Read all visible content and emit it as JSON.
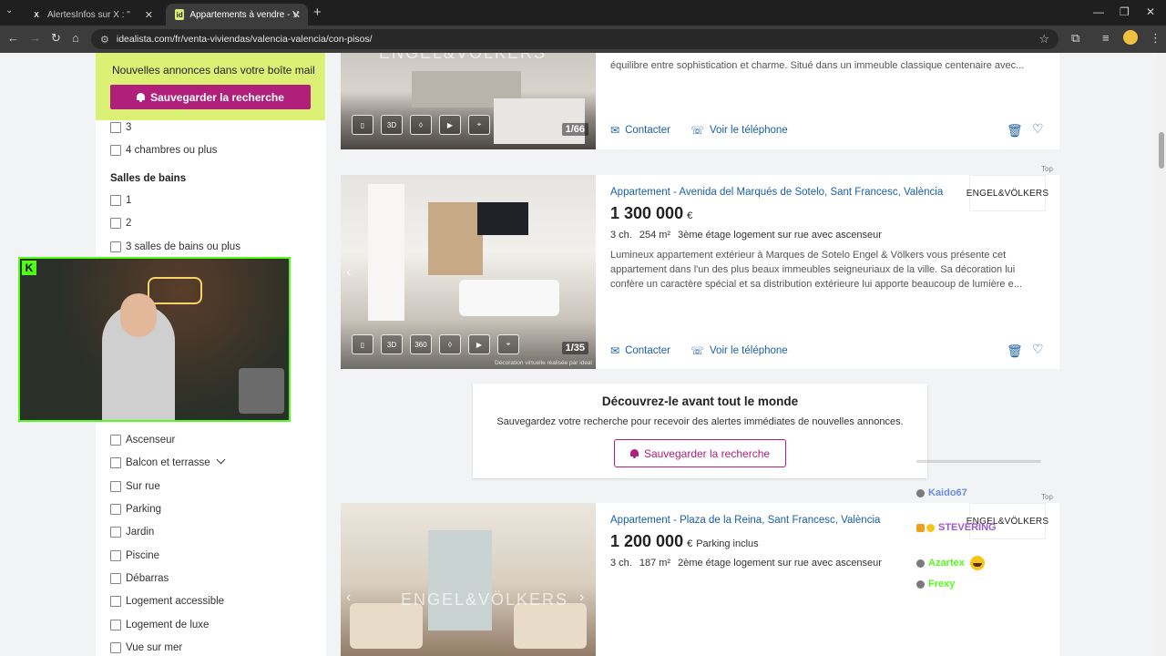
{
  "browser": {
    "tabs": [
      {
        "title": "AlertesInfos sur X : \"",
        "favicon": "X",
        "active": false
      },
      {
        "title": "Appartements à vendre - Valen",
        "favicon": "id",
        "active": true
      }
    ],
    "new_tab": "+",
    "url": "idealista.com/fr/venta-viviendas/valencia-valencia/con-pisos/"
  },
  "sidebar": {
    "alert_title": "Nouvelles annonces dans votre boîte mail",
    "save_button": "Sauvegarder la recherche",
    "bedrooms_options": [
      "3",
      "4 chambres ou plus"
    ],
    "bathrooms_heading": "Salles de bains",
    "bathrooms_options": [
      "1",
      "2",
      "3 salles de bains ou plus"
    ],
    "features": [
      "Ascenseur",
      "Balcon et terrasse",
      "Sur rue",
      "Parking",
      "Jardin",
      "Piscine",
      "Débarras",
      "Logement accessible",
      "Logement de luxe",
      "Vue sur mer"
    ]
  },
  "listings": [
    {
      "desc_line": "équilibre entre sophistication et charme. Situé dans un immeuble classique centenaire avec...",
      "photo_counter": "1/66",
      "watermark": "ENGEL&VÖLKERS",
      "contact": "Contacter",
      "phone": "Voir le téléphone"
    },
    {
      "title": "Appartement - Avenida del Marqués de Sotelo, Sant Francesc, València",
      "price": "1 300 000",
      "currency": "€",
      "rooms": "3 ch.",
      "area": "254 m²",
      "floor": "3ème étage logement sur rue avec ascenseur",
      "desc": [
        "Lumineux appartement extérieur à Marques de Sotelo Engel & Völkers vous présente cet",
        "appartement dans l'un des plus beaux immeubles seigneuriaux de la ville. Sa décoration lui",
        "confère un caractère spécial et sa distribution extérieure lui apporte beaucoup de lumière e..."
      ],
      "agency": "ENGEL&VÖLKERS",
      "top_tag": "Top",
      "photo_counter": "1/35",
      "virtual_note": "Décoration virtuelle réalisée par ideal",
      "contact": "Contacter",
      "phone": "Voir le téléphone"
    },
    {
      "title": "Appartement - Plaza de la Reina, Sant Francesc, València",
      "price": "1 200 000",
      "currency": "€",
      "extra": "Parking inclus",
      "rooms": "3 ch.",
      "area": "187 m²",
      "floor": "2ème étage logement sur rue avec ascenseur",
      "agency": "ENGEL&VÖLKERS",
      "top_tag": "Top",
      "watermark": "ENGEL&VÖLKERS"
    }
  ],
  "promo": {
    "title": "Découvrez-le avant tout le monde",
    "text": "Sauvegardez votre recherche pour recevoir des alertes immédiates de nouvelles annonces.",
    "button": "Sauvegarder la recherche"
  },
  "chat": [
    {
      "user": "Kaido67",
      "color": "#6b8fe0"
    },
    {
      "user": "STEVERING",
      "color": "#9b59d0"
    },
    {
      "user": "Azartex",
      "color": "#53fc18"
    },
    {
      "user": "Frexy",
      "color": "#53fc18"
    }
  ],
  "colors": {
    "brand_magenta": "#b0207a",
    "link_blue": "#1a5fa8",
    "alert_lime": "#dcf075",
    "kick_green": "#53fc18"
  }
}
